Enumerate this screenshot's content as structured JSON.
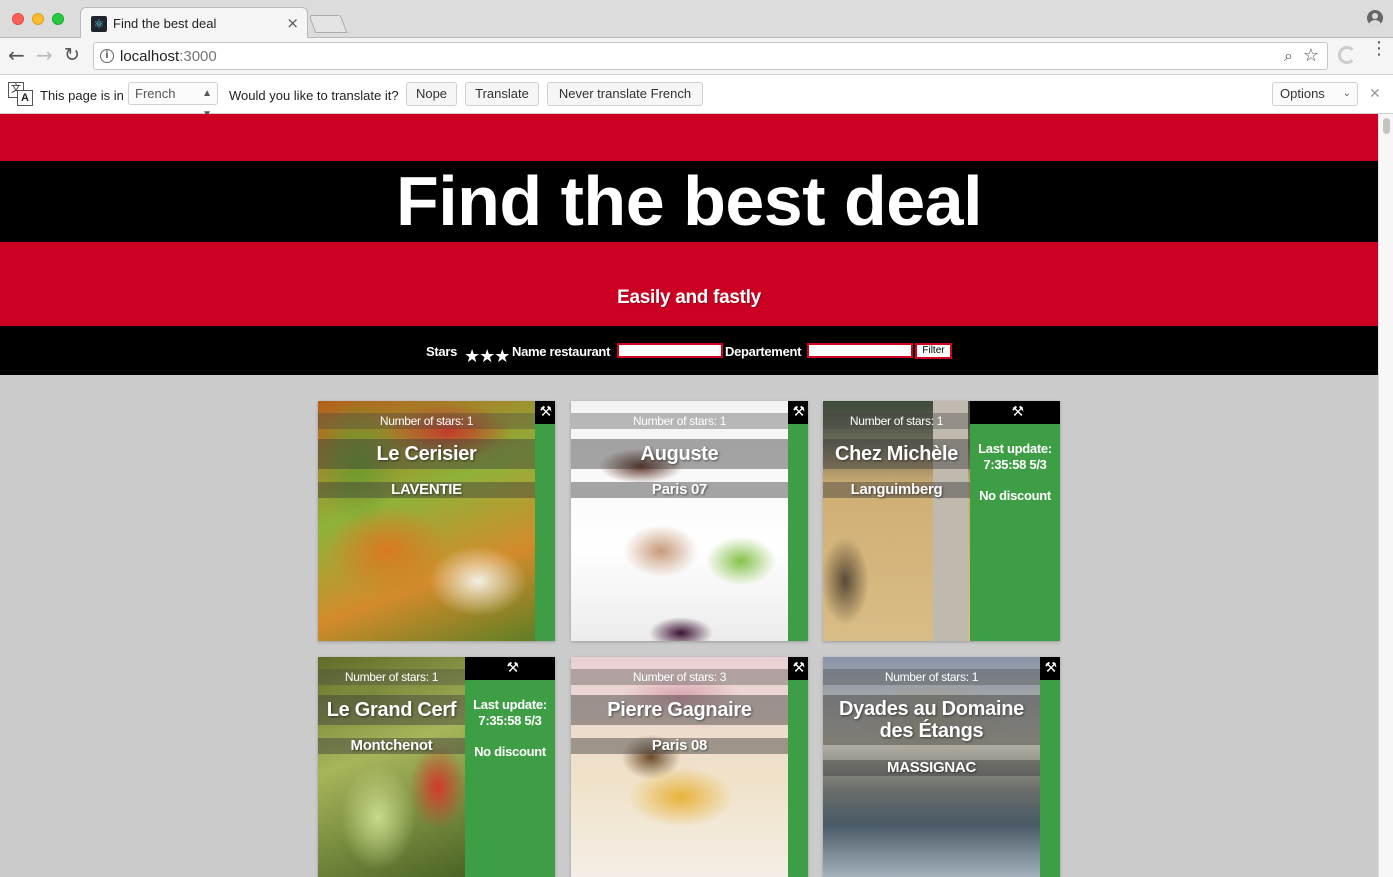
{
  "browser": {
    "tab_title": "Find the best deal",
    "url_host": "localhost",
    "url_port": ":3000"
  },
  "translate_bar": {
    "page_is_in": "This page is in",
    "language": "French",
    "question": "Would you like to translate it?",
    "nope": "Nope",
    "translate": "Translate",
    "never": "Never translate French",
    "options": "Options"
  },
  "header": {
    "title": "Find the best deal",
    "subtitle": "Easily and fastly"
  },
  "filters": {
    "stars_label": "Stars",
    "stars_value": "★★★",
    "name_label": "Name restaurant",
    "name_value": "",
    "departement_label": "Departement",
    "departement_value": "",
    "filter_button": "Filter"
  },
  "cards": [
    {
      "stars": "Number of stars: 1",
      "name": "Le Cerisier",
      "city": "LAVENTIE"
    },
    {
      "stars": "Number of stars: 1",
      "name": "Auguste",
      "city": "Paris 07"
    },
    {
      "stars": "Number of stars: 1",
      "name": "Chez Michèle",
      "city": "Languimberg",
      "last_update": "Last update: 7:35:58 5/3",
      "discount": "No discount"
    },
    {
      "stars": "Number of stars: 1",
      "name": "Le Grand Cerf",
      "city": "Montchenot",
      "last_update": "Last update: 7:35:58 5/3",
      "discount": "No discount"
    },
    {
      "stars": "Number of stars: 3",
      "name": "Pierre Gagnaire",
      "city": "Paris 08"
    },
    {
      "stars": "Number of stars: 1",
      "name": "Dyades au Domaine des Étangs",
      "city": "MASSIGNAC"
    }
  ],
  "colors": {
    "brand_red": "#cc0022",
    "discount_green": "#3e9e46",
    "page_background": "#cbcbcb"
  },
  "icons": [
    "react-favicon-icon",
    "back-arrow-icon",
    "forward-arrow-icon",
    "reload-icon",
    "info-icon",
    "zoom-icon",
    "bookmark-star-icon",
    "extension-icon",
    "menu-icon",
    "profile-icon",
    "translate-icon",
    "wrench-icon"
  ]
}
